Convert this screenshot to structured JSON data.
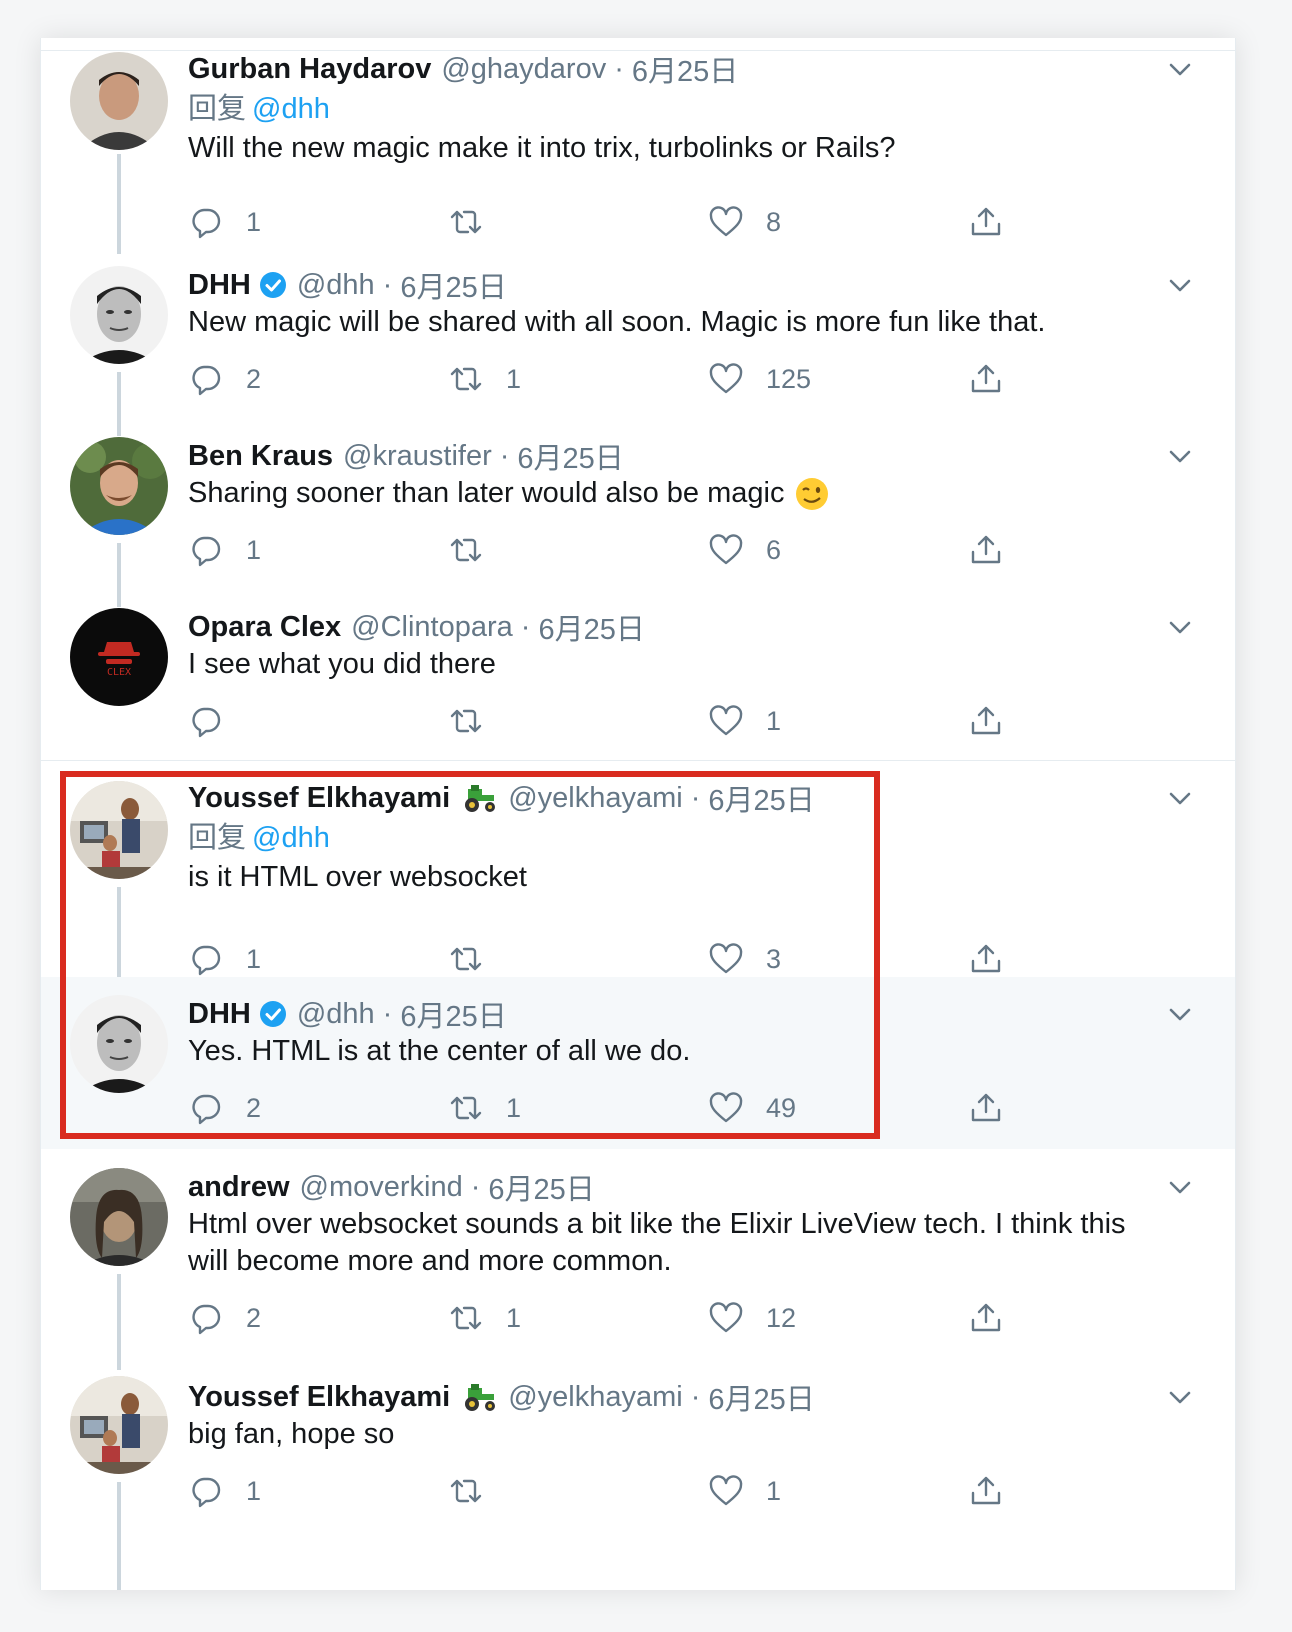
{
  "tweets": [
    {
      "name": "Gurban Haydarov",
      "handle": "@ghaydarov",
      "date": "6月25日",
      "replying_prefix": "回复",
      "replying_to": "@dhh",
      "text": "Will the new magic make it into trix, turbolinks or Rails?",
      "replies": "1",
      "retweets": "",
      "likes": "8"
    },
    {
      "name": "DHH",
      "handle": "@dhh",
      "date": "6月25日",
      "verified": true,
      "text": "New magic will be shared with all soon. Magic is more fun like that.",
      "replies": "2",
      "retweets": "1",
      "likes": "125"
    },
    {
      "name": "Ben Kraus",
      "handle": "@kraustifer",
      "date": "6月25日",
      "text": "Sharing sooner than later would also be magic",
      "text_emoji": "winking-face-emoji",
      "replies": "1",
      "retweets": "",
      "likes": "6"
    },
    {
      "name": "Opara Clex",
      "handle": "@Clintopara",
      "date": "6月25日",
      "text": "I see what you did there",
      "avatar_text": "CLEX",
      "replies": "",
      "retweets": "",
      "likes": "1"
    },
    {
      "name": "Youssef Elkhayami",
      "handle": "@yelkhayami",
      "date": "6月25日",
      "name_emoji": "tractor-emoji",
      "replying_prefix": "回复",
      "replying_to": "@dhh",
      "text": "is it HTML over websocket",
      "replies": "1",
      "retweets": "",
      "likes": "3"
    },
    {
      "name": "DHH",
      "handle": "@dhh",
      "date": "6月25日",
      "verified": true,
      "text": "Yes. HTML is at the center of all we do.",
      "replies": "2",
      "retweets": "1",
      "likes": "49"
    },
    {
      "name": "andrew",
      "handle": "@moverkind",
      "date": "6月25日",
      "text_line1": "Html over websocket sounds a bit like the Elixir LiveView tech. I think this",
      "text_line2": "will become more and more common.",
      "replies": "2",
      "retweets": "1",
      "likes": "12"
    },
    {
      "name": "Youssef Elkhayami",
      "handle": "@yelkhayami",
      "date": "6月25日",
      "name_emoji": "tractor-emoji",
      "text": "big fan, hope so",
      "replies": "1",
      "retweets": "",
      "likes": "1"
    }
  ],
  "separator": "·",
  "colors": {
    "accent": "#1da1f2",
    "secondary_text": "#657786",
    "highlight_box": "#d92b1f",
    "highlight_bg": "#f5f8fa"
  }
}
